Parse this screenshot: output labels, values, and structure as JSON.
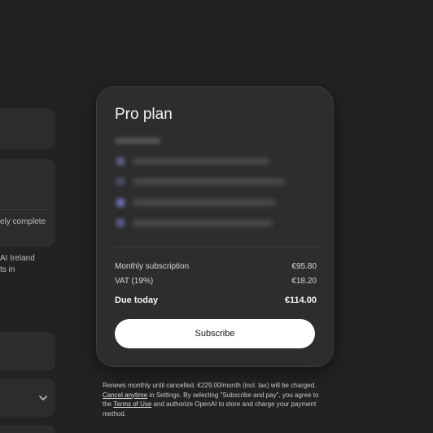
{
  "left_panel": {
    "snippet_1": "ely complete",
    "snippet_2": "AI Ireland",
    "snippet_3": "ts in"
  },
  "icons": {
    "dropdown": "chevron-down-icon"
  },
  "modal": {
    "title": "Pro plan",
    "feature_icon_colors": [
      "#5d6080",
      "#4a4d66",
      "#6a6dab",
      "#585b8a"
    ],
    "summary": {
      "monthly_label": "Monthly subscription",
      "monthly_value": "€95.80",
      "vat_label": "VAT (19%)",
      "vat_value": "€18.20",
      "due_label": "Due today",
      "due_value": "€114.00"
    },
    "subscribe_label": "Subscribe"
  },
  "legal": {
    "part1": "Renews monthly until cancelled. €229.00/month (incl. tax) will be charged. ",
    "cancel_link": "Cancel anytime",
    "part2": " in Settings. By selecting \"Subscribe and pay\", you agree to the ",
    "terms_link": "Terms of Use",
    "part3": " and authorize OpenAI to store and charge your payment method."
  }
}
